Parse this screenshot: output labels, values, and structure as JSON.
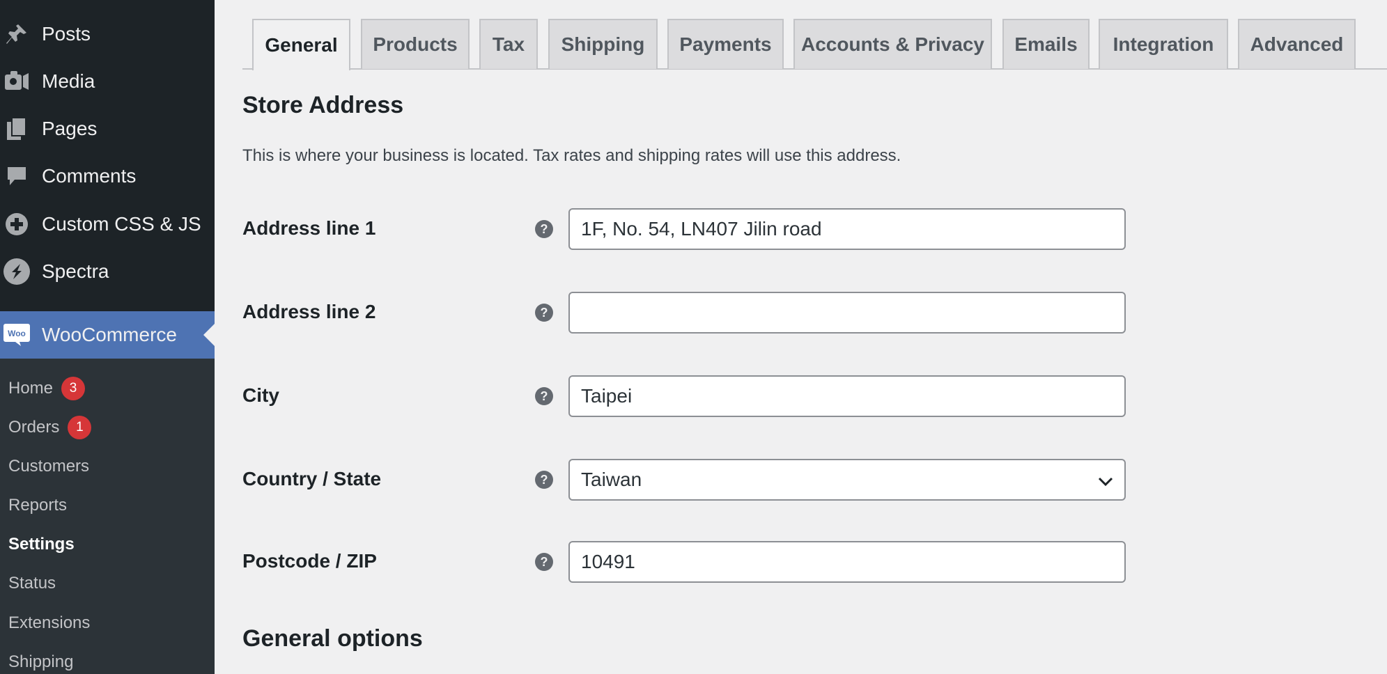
{
  "sidebar": {
    "menu": [
      {
        "label": "Posts",
        "icon": "pin-icon"
      },
      {
        "label": "Media",
        "icon": "media-icon"
      },
      {
        "label": "Pages",
        "icon": "pages-icon"
      },
      {
        "label": "Comments",
        "icon": "comment-icon"
      },
      {
        "label": "Custom CSS & JS",
        "icon": "plus-circle-icon"
      },
      {
        "label": "Spectra",
        "icon": "spectra-icon"
      }
    ],
    "woocommerce": {
      "label": "WooCommerce",
      "logo_text": "Woo",
      "accent": "#4e73b3"
    },
    "submenu": [
      {
        "label": "Home",
        "badge": "3"
      },
      {
        "label": "Orders",
        "badge": "1"
      },
      {
        "label": "Customers"
      },
      {
        "label": "Reports"
      },
      {
        "label": "Settings",
        "current": true
      },
      {
        "label": "Status"
      },
      {
        "label": "Extensions"
      },
      {
        "label": "Shipping"
      }
    ],
    "badge_color": "#d63638"
  },
  "tabs": [
    {
      "label": "General",
      "active": true
    },
    {
      "label": "Products"
    },
    {
      "label": "Tax"
    },
    {
      "label": "Shipping"
    },
    {
      "label": "Payments"
    },
    {
      "label": "Accounts & Privacy"
    },
    {
      "label": "Emails"
    },
    {
      "label": "Integration"
    },
    {
      "label": "Advanced"
    }
  ],
  "store_address": {
    "title": "Store Address",
    "description": "This is where your business is located. Tax rates and shipping rates will use this address.",
    "fields": {
      "address1": {
        "label": "Address line 1",
        "value": "1F, No. 54, LN407 Jilin road"
      },
      "address2": {
        "label": "Address line 2",
        "value": ""
      },
      "city": {
        "label": "City",
        "value": "Taipei"
      },
      "country": {
        "label": "Country / State",
        "value": "Taiwan"
      },
      "postcode": {
        "label": "Postcode / ZIP",
        "value": "10491"
      }
    },
    "help_glyph": "?"
  },
  "general_options": {
    "title": "General options"
  }
}
